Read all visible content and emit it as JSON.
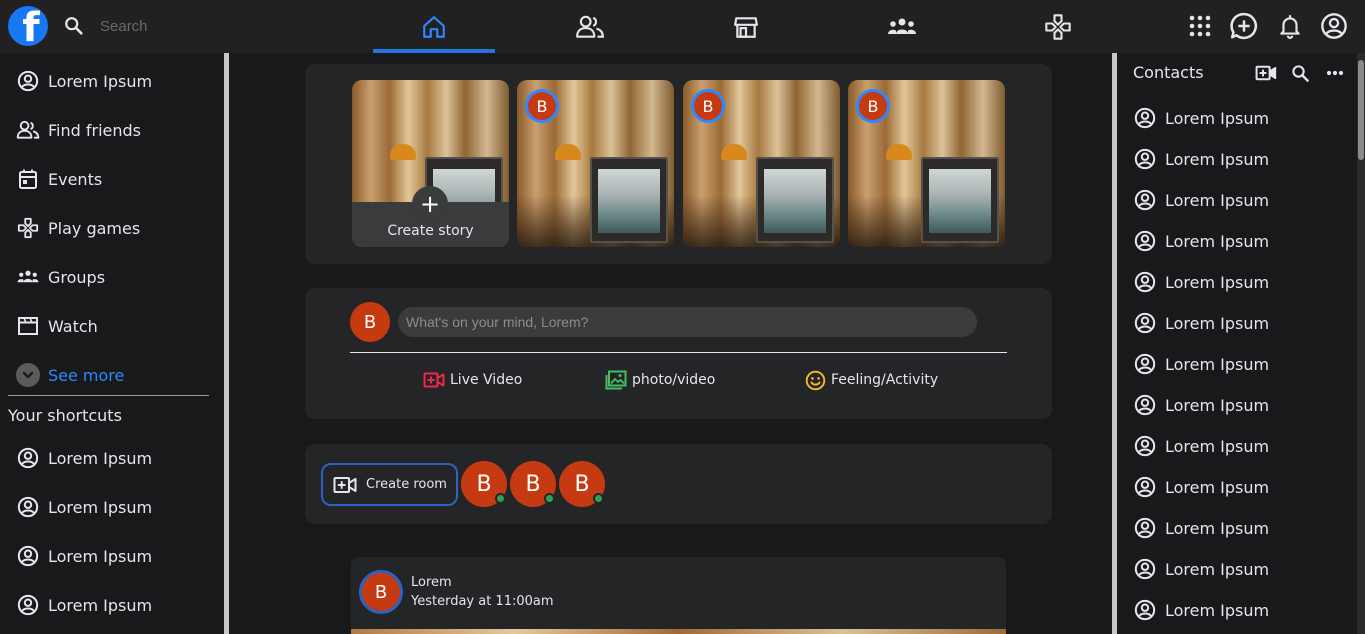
{
  "topbar": {
    "logo_letter": "f",
    "search_placeholder": "Search",
    "nav_tabs": [
      {
        "name": "home",
        "icon": "home-icon",
        "active": true
      },
      {
        "name": "friends",
        "icon": "friends-icon",
        "active": false
      },
      {
        "name": "marketplace",
        "icon": "store-icon",
        "active": false
      },
      {
        "name": "groups",
        "icon": "groups-icon",
        "active": false
      },
      {
        "name": "gaming",
        "icon": "gamepad-icon",
        "active": false
      }
    ],
    "right_icons": [
      "apps-grid-icon",
      "messenger-add-icon",
      "bell-icon",
      "account-circle-icon"
    ],
    "accent_color": "#2374e1"
  },
  "left_sidebar": {
    "items": [
      {
        "label": "Lorem Ipsum",
        "icon": "account-circle-icon"
      },
      {
        "label": "Find friends",
        "icon": "friends-icon"
      },
      {
        "label": "Events",
        "icon": "calendar-icon"
      },
      {
        "label": "Play games",
        "icon": "gamepad-icon"
      },
      {
        "label": "Groups",
        "icon": "groups-icon"
      },
      {
        "label": "Watch",
        "icon": "video-icon"
      }
    ],
    "see_more": "See more",
    "shortcuts_title": "Your shortcuts",
    "shortcuts": [
      {
        "label": "Lorem Ipsum",
        "icon": "account-circle-icon"
      },
      {
        "label": "Lorem Ipsum",
        "icon": "account-circle-icon"
      },
      {
        "label": "Lorem Ipsum",
        "icon": "account-circle-icon"
      },
      {
        "label": "Lorem Ipsum",
        "icon": "account-circle-icon"
      }
    ]
  },
  "stories": {
    "create_label": "Create story",
    "create_plus": "+",
    "story_avatars": [
      "B",
      "B",
      "B"
    ]
  },
  "composer": {
    "avatar_letter": "B",
    "placeholder": "What's on your mind, Lorem?",
    "actions": [
      {
        "label": "Live Video",
        "icon": "live-video-icon",
        "color": "#f02849"
      },
      {
        "label": "photo/video",
        "icon": "photo-icon",
        "color": "#45bd62"
      },
      {
        "label": "Feeling/Activity",
        "icon": "smiley-icon",
        "color": "#f7b928"
      }
    ]
  },
  "rooms": {
    "create_label": "Create room",
    "avatars": [
      "B",
      "B",
      "B"
    ],
    "online_color": "#31a24c"
  },
  "post": {
    "avatar_letter": "B",
    "author": "Lorem",
    "time": "Yesterday at 11:00am"
  },
  "right_sidebar": {
    "title": "Contacts",
    "header_icons": [
      "video-add-icon",
      "search-icon",
      "more-icon"
    ],
    "contacts": [
      "Lorem Ipsum",
      "Lorem Ipsum",
      "Lorem Ipsum",
      "Lorem Ipsum",
      "Lorem Ipsum",
      "Lorem Ipsum",
      "Lorem Ipsum",
      "Lorem Ipsum",
      "Lorem Ipsum",
      "Lorem Ipsum",
      "Lorem Ipsum",
      "Lorem Ipsum",
      "Lorem Ipsum"
    ]
  }
}
